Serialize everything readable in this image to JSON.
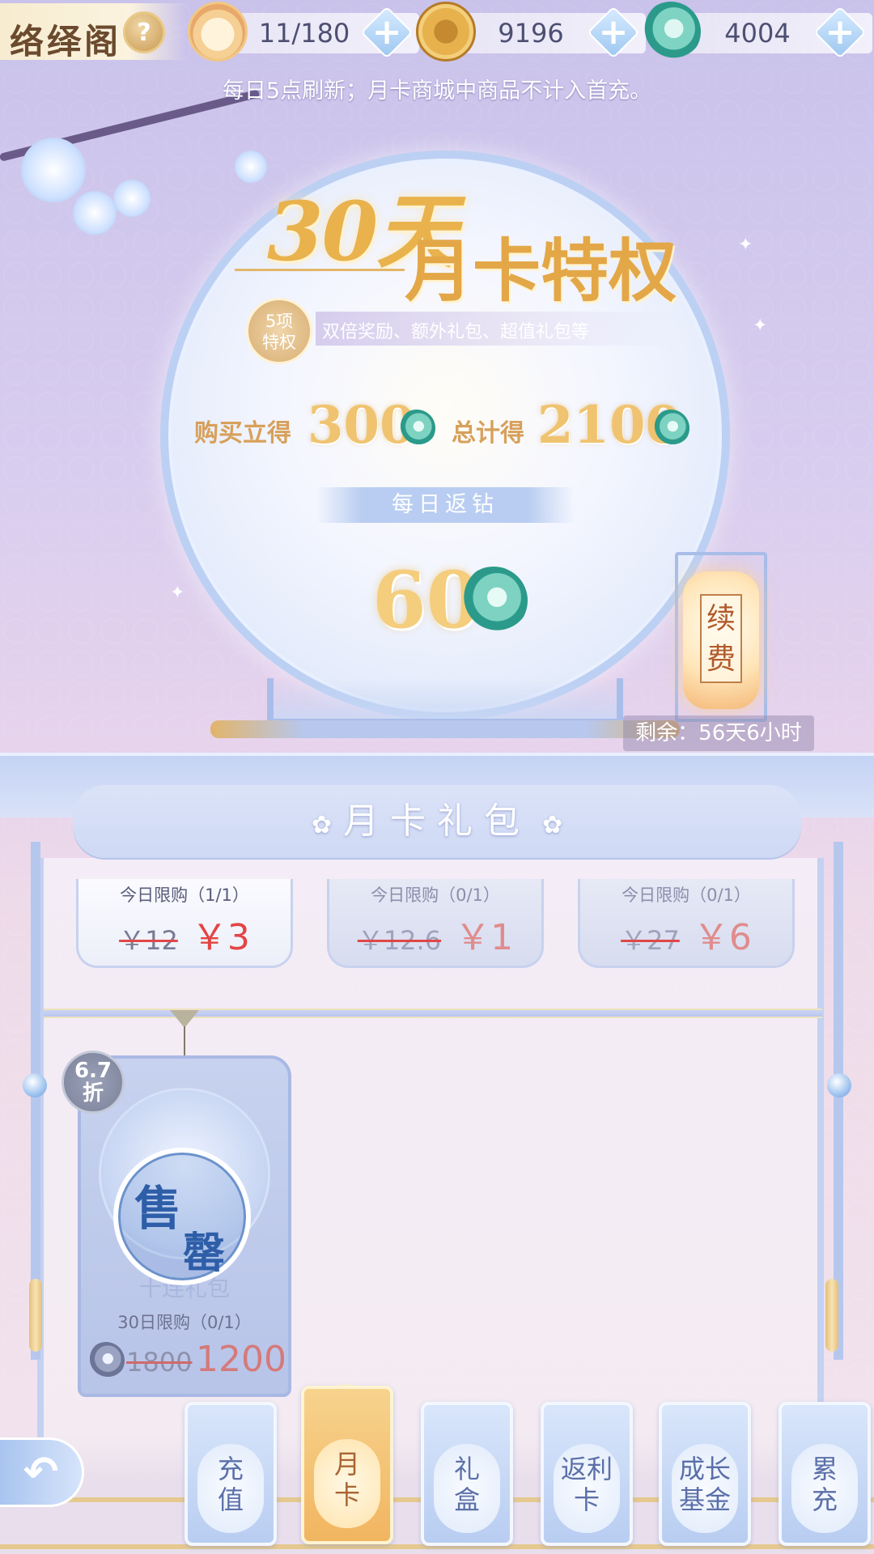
{
  "header": {
    "title": "络绎阁",
    "help_label": "?",
    "resources": [
      {
        "icon": "stamina-cat-icon",
        "value": "11/180"
      },
      {
        "icon": "gold-coin-icon",
        "value": "9196"
      },
      {
        "icon": "jade-currency-icon",
        "value": "4004"
      }
    ],
    "plus_label": "+"
  },
  "notice": "每日5点刷新；月卡商城中商品不计入首充。",
  "banner": {
    "headline_days": "30天",
    "headline_title": "月卡特权",
    "priv_badge_line1": "5项",
    "priv_badge_line2": "特权",
    "priv_desc": "双倍奖励、额外礼包、超值礼包等",
    "buy_label": "购买立得",
    "buy_value": "300",
    "total_label": "总计得",
    "total_value": "2100",
    "daily_label": "每日返钻",
    "daily_value": "60"
  },
  "renew": {
    "label": "续费",
    "remaining": "剩余：56天6小时"
  },
  "panel": {
    "title": "月卡礼包"
  },
  "gifts_top": [
    {
      "limit": "今日限购（1/1）",
      "old_price": "￥12",
      "new_price": "￥3",
      "state": "active"
    },
    {
      "limit": "今日限购（0/1）",
      "old_price": "￥12.6",
      "new_price": "￥1",
      "state": "dim"
    },
    {
      "limit": "今日限购（0/1）",
      "old_price": "￥27",
      "new_price": "￥6",
      "state": "dim"
    }
  ],
  "sold_card": {
    "discount_line1": "6.7",
    "discount_line2": "折",
    "name": "十连礼包",
    "stamp_char1": "售",
    "stamp_char2": "罄",
    "limit": "30日限购（0/1）",
    "old_price": "1800",
    "new_price": "1200"
  },
  "nav": {
    "back_label": "↶",
    "tabs": [
      {
        "line1": "充",
        "line2": "值",
        "active": false
      },
      {
        "line1": "月",
        "line2": "卡",
        "active": true
      },
      {
        "line1": "礼",
        "line2": "盒",
        "active": false
      },
      {
        "line1": "返利",
        "line2": "卡",
        "active": false
      },
      {
        "line1": "成长",
        "line2": "基金",
        "active": false
      },
      {
        "line1": "累",
        "line2": "充",
        "active": false
      }
    ]
  },
  "colors": {
    "accent_gold": "#e9b24d",
    "price_red": "#e44444",
    "panel_blue": "#c4d1f2"
  }
}
